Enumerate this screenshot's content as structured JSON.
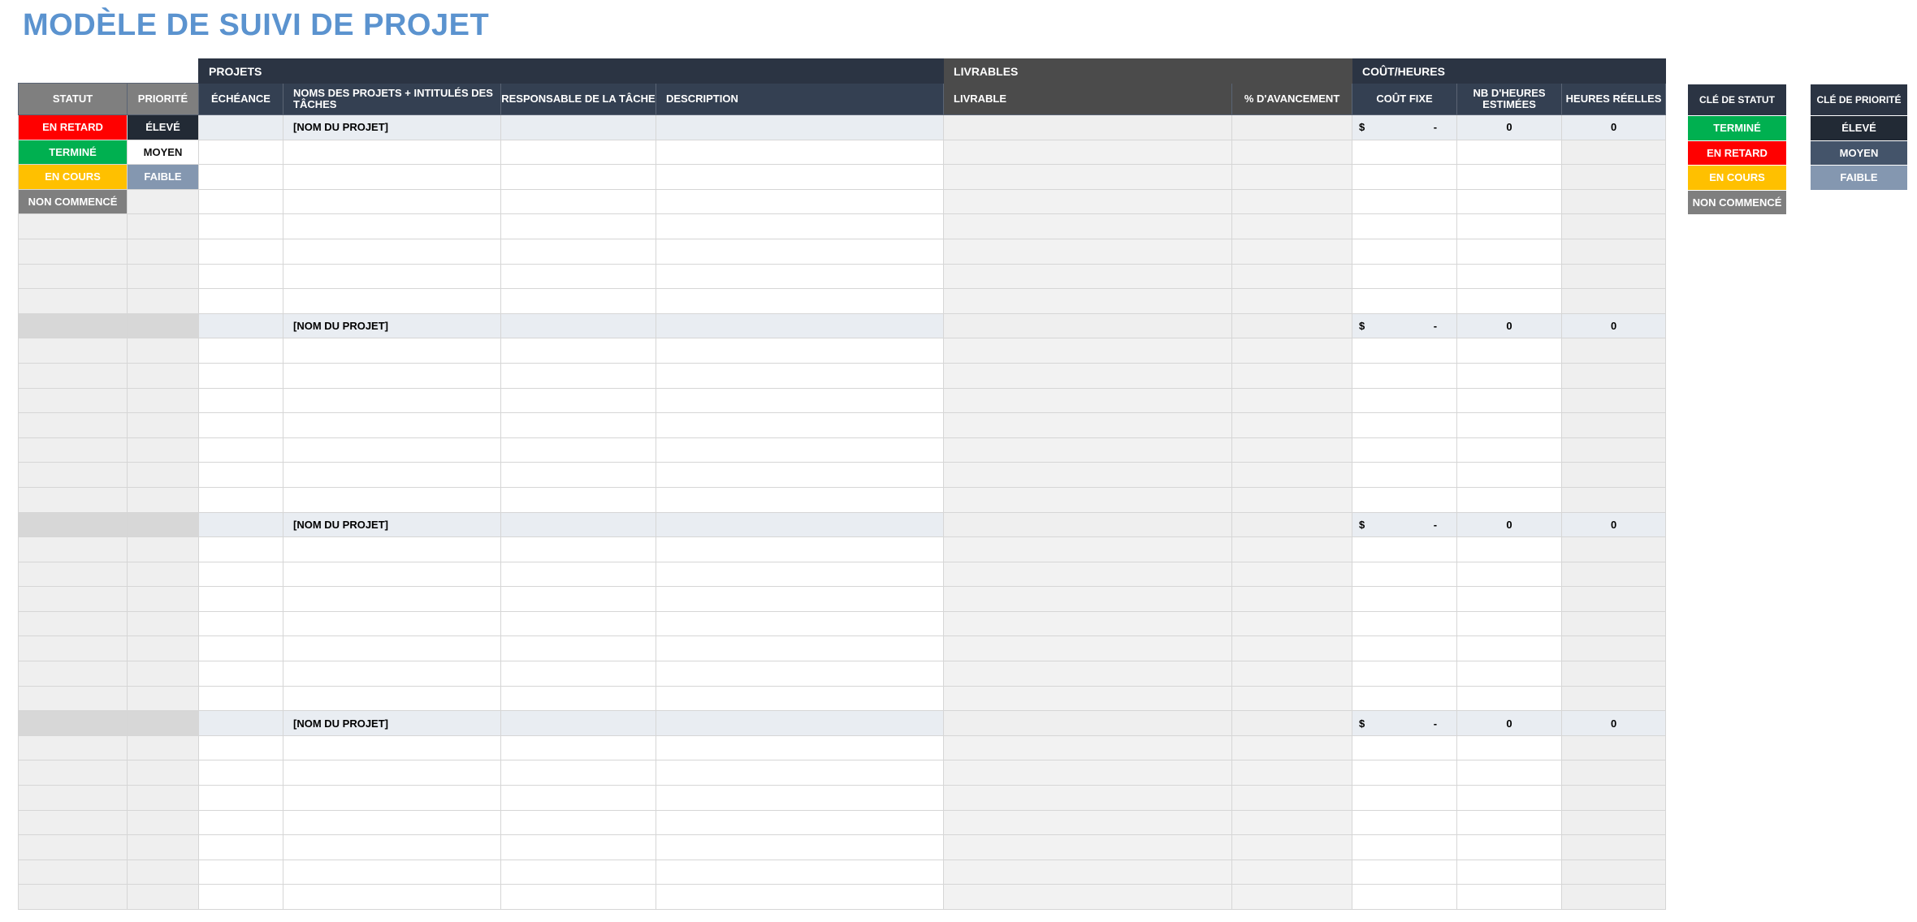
{
  "title": "MODÈLE DE SUIVI DE PROJET",
  "groups": {
    "projets": "PROJETS",
    "livrables": "LIVRABLES",
    "cout": "COÛT/HEURES"
  },
  "headers": {
    "statut": "STATUT",
    "priorite": "PRIORITÉ",
    "echeance": "ÉCHÉANCE",
    "noms": "NOMS DES PROJETS + INTITULÉS DES TÂCHES",
    "responsable": "RESPONSABLE DE LA TÂCHE",
    "description": "DESCRIPTION",
    "livrable": "LIVRABLE",
    "avancement": "% D'AVANCEMENT",
    "cout_fixe": "COÛT FIXE",
    "heures_est": "NB D'HEURES ESTIMÉES",
    "heures_reelles": "HEURES RÉELLES"
  },
  "first_rows": [
    {
      "statut": "EN RETARD",
      "statut_color": "#ff0000",
      "priorite": "ÉLEVÉ",
      "priorite_color": "#222a35"
    },
    {
      "statut": "TERMINÉ",
      "statut_color": "#00b050",
      "priorite": "MOYEN",
      "priorite_color": "#ffffff"
    },
    {
      "statut": "EN COURS",
      "statut_color": "#ffc000",
      "priorite": "FAIBLE",
      "priorite_color": "#8497b0"
    },
    {
      "statut": "NON COMMENCÉ",
      "statut_color": "#7f7f7f",
      "priorite": "",
      "priorite_color": ""
    }
  ],
  "projects": [
    {
      "name": "[NOM DU PROJET]",
      "cost_symbol": "$",
      "cost_value": "-",
      "est_hours": "0",
      "real_hours": "0"
    },
    {
      "name": "[NOM DU PROJET]",
      "cost_symbol": "$",
      "cost_value": "-",
      "est_hours": "0",
      "real_hours": "0"
    },
    {
      "name": "[NOM DU PROJET]",
      "cost_symbol": "$",
      "cost_value": "-",
      "est_hours": "0",
      "real_hours": "0"
    },
    {
      "name": "[NOM DU PROJET]",
      "cost_symbol": "$",
      "cost_value": "-",
      "est_hours": "0",
      "real_hours": "0"
    }
  ],
  "status_key": {
    "title": "CLÉ DE STATUT",
    "items": [
      {
        "label": "TERMINÉ",
        "color": "#00b050"
      },
      {
        "label": "EN RETARD",
        "color": "#ff0000"
      },
      {
        "label": "EN COURS",
        "color": "#ffc000"
      },
      {
        "label": "NON COMMENCÉ",
        "color": "#7f7f7f"
      }
    ]
  },
  "priority_key": {
    "title": "CLÉ DE PRIORITÉ",
    "items": [
      {
        "label": "ÉLEVÉ",
        "color": "#222a35"
      },
      {
        "label": "MOYEN",
        "color": "#44546a"
      },
      {
        "label": "FAIBLE",
        "color": "#8497b0"
      }
    ]
  }
}
